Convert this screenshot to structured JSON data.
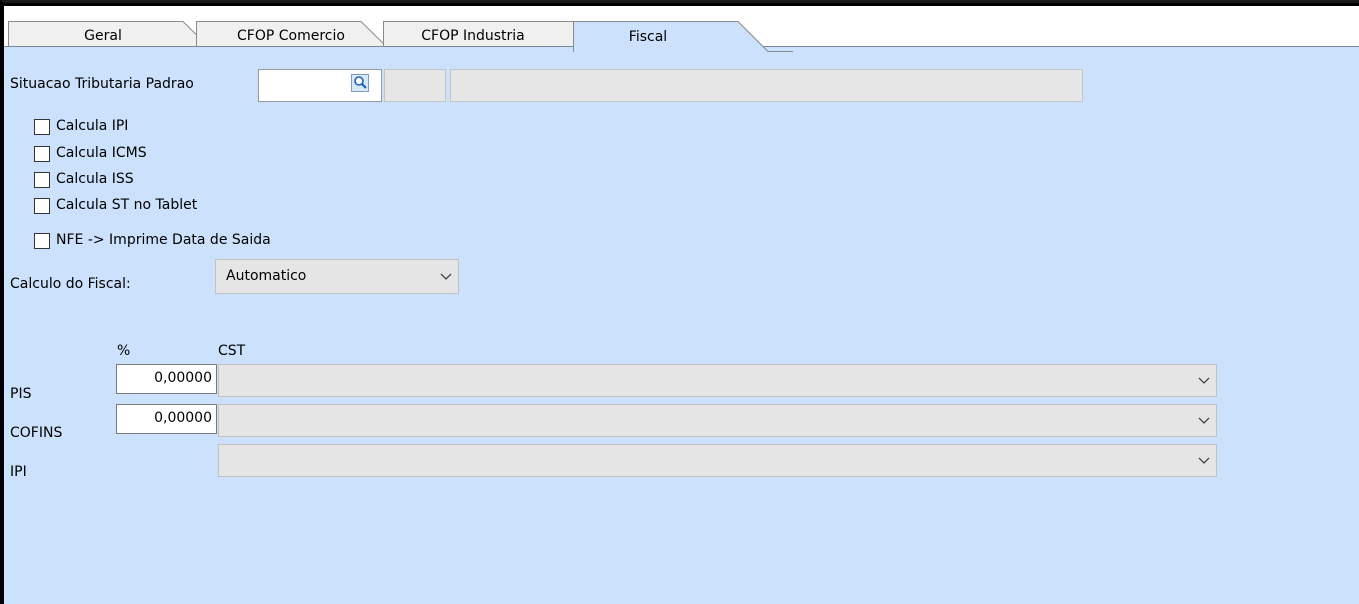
{
  "tabs": [
    {
      "label": "Geral",
      "active": false
    },
    {
      "label": "CFOP Comercio",
      "active": false
    },
    {
      "label": "CFOP Industria",
      "active": false
    },
    {
      "label": "Fiscal",
      "active": true
    }
  ],
  "situacao": {
    "label": "Situacao Tributaria Padrao",
    "code_value": "",
    "search_icon": "magnifier-icon"
  },
  "checkboxes": [
    {
      "label": "Calcula IPI",
      "checked": false
    },
    {
      "label": "Calcula ICMS",
      "checked": false
    },
    {
      "label": "Calcula ISS",
      "checked": false
    },
    {
      "label": "Calcula ST no Tablet",
      "checked": false
    },
    {
      "label": "NFE -> Imprime Data de Saida",
      "checked": false
    }
  ],
  "calculo_fiscal": {
    "label": "Calculo do Fiscal:",
    "selected": "Automatico"
  },
  "taxes": {
    "percent_header": "%",
    "cst_header": "CST",
    "rows": [
      {
        "label": "PIS",
        "percent": "0,00000",
        "cst": ""
      },
      {
        "label": "COFINS",
        "percent": "0,00000",
        "cst": ""
      },
      {
        "label": "IPI",
        "cst": ""
      }
    ]
  },
  "colors": {
    "panel_bg": "#cce1fb",
    "tab_active_bg": "#cce1fb",
    "tab_inactive_bg": "#f0f0f0"
  }
}
